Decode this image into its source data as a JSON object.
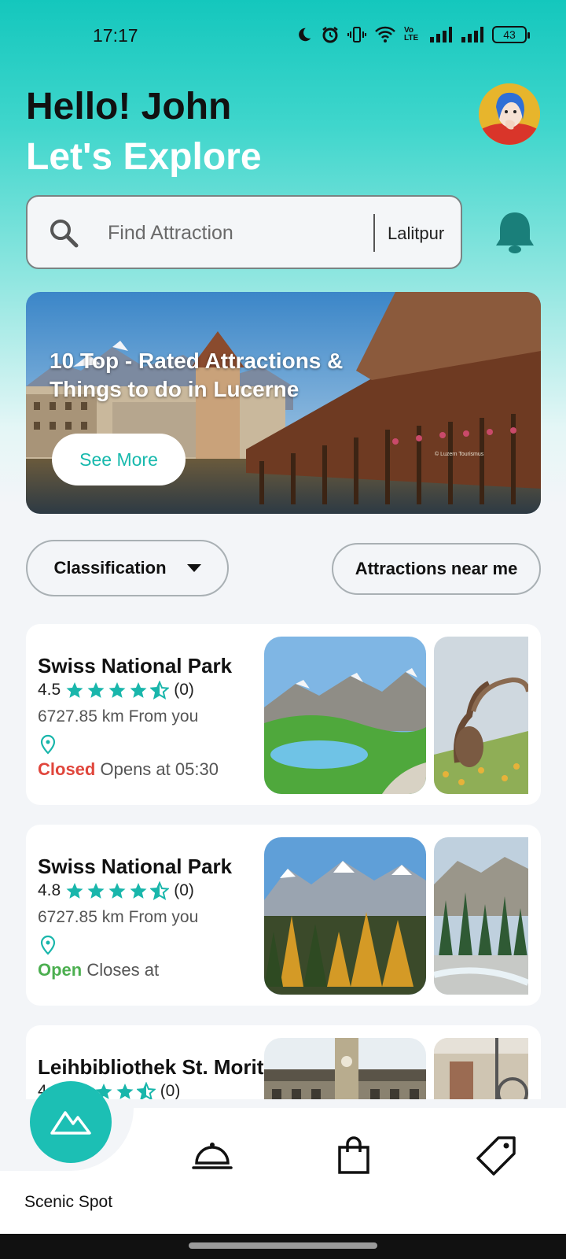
{
  "status_bar": {
    "time": "17:17",
    "battery": "43",
    "volte": "Vo LTE"
  },
  "header": {
    "greeting": "Hello! John",
    "subtitle": "Let's Explore"
  },
  "search": {
    "placeholder": "Find Attraction",
    "location": "Lalitpur"
  },
  "banner": {
    "title": "10 Top - Rated Attractions & Things to do in Lucerne",
    "button_label": "See More",
    "watermark": "© Luzern Tourismus"
  },
  "filters": {
    "classification_label": "Classification",
    "near_me_label": "Attractions near me"
  },
  "attractions": [
    {
      "name": "Swiss National Park",
      "rating": "4.5",
      "reviews": "(0)",
      "distance": "6727.85 km From you",
      "status": "Closed",
      "status_detail": "Opens at 05:30"
    },
    {
      "name": "Swiss National Park",
      "rating": "4.8",
      "reviews": "(0)",
      "distance": "6727.85 km From you",
      "status": "Open",
      "status_detail": "Closes at"
    },
    {
      "name": "Leihbibliothek St. Moritz",
      "rating": "4",
      "reviews": "(0)",
      "distance": "",
      "status": "",
      "status_detail": ""
    }
  ],
  "bottom_nav": {
    "active_label": "Scenic Spot",
    "items": [
      "mountain-icon",
      "food-cloche-icon",
      "shopping-bag-icon",
      "tag-icon"
    ]
  },
  "colors": {
    "accent": "#1cbfb4",
    "closed": "#e0463c",
    "open": "#4caf50"
  }
}
